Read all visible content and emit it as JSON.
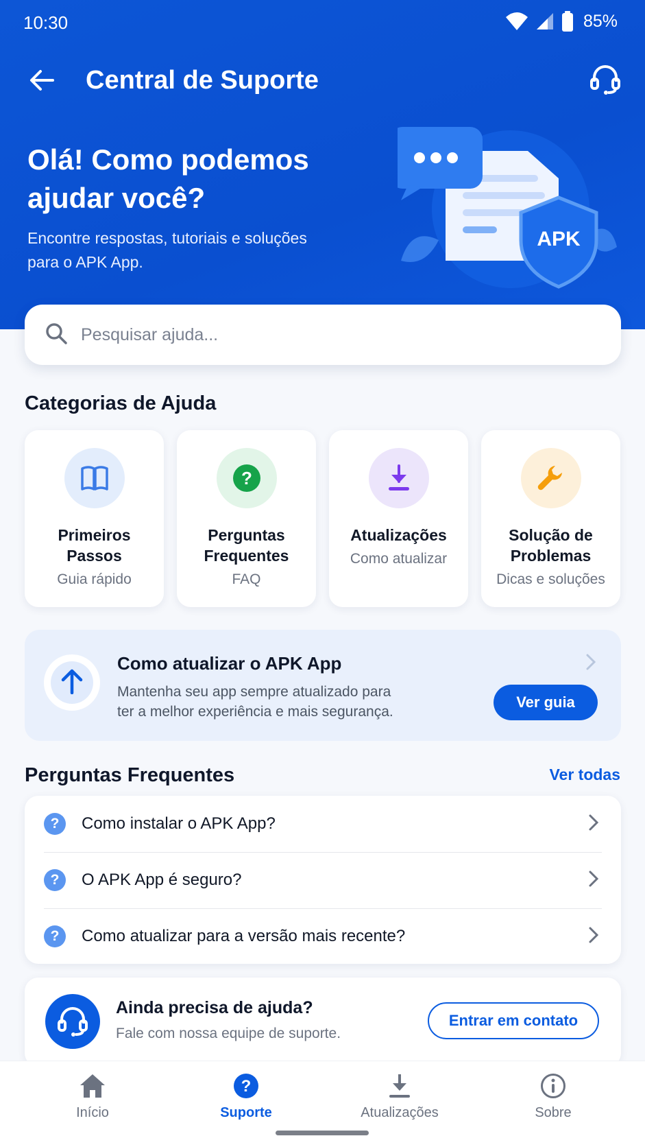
{
  "status_bar": {
    "time": "10:30",
    "battery": "85%",
    "icons": [
      "wifi-icon",
      "signal-icon",
      "battery-icon"
    ]
  },
  "app_bar": {
    "title": "Central de Suporte",
    "back_icon": "arrow-left-icon",
    "action_icon": "headset-icon"
  },
  "hero": {
    "title": "Olá! Como podemos ajudar você?",
    "subtitle": "Encontre respostas, tutoriais e soluções para o APK App.",
    "illustration_badge": "APK"
  },
  "search": {
    "placeholder": "Pesquisar ajuda...",
    "value": ""
  },
  "categories": {
    "title": "Categorias de Ajuda",
    "items": [
      {
        "title": "Primeiros Passos",
        "subtitle": "Guia rápido",
        "icon": "book-icon",
        "color": "#3b7be6",
        "bg": "#e3edfc"
      },
      {
        "title": "Perguntas Frequentes",
        "subtitle": "FAQ",
        "icon": "question-circle-icon",
        "color": "#16a34a",
        "bg": "#e2f5e8"
      },
      {
        "title": "Atualizações",
        "subtitle": "Como atualizar",
        "icon": "download-icon",
        "color": "#7c3aed",
        "bg": "#ece5fb"
      },
      {
        "title": "Solução de Problemas",
        "subtitle": "Dicas e soluções",
        "icon": "wrench-icon",
        "color": "#f59e0b",
        "bg": "#fdf0da"
      }
    ]
  },
  "update_card": {
    "title": "Como atualizar o APK App",
    "description": "Mantenha seu app sempre atualizado para ter a melhor experiência e mais segurança.",
    "button": "Ver guia",
    "icon": "arrow-up-icon"
  },
  "faq": {
    "title": "Perguntas Frequentes",
    "see_all": "Ver todas",
    "items": [
      {
        "question": "Como instalar o APK App?"
      },
      {
        "question": "O APK App é seguro?"
      },
      {
        "question": "Como atualizar para a versão mais recente?"
      }
    ]
  },
  "help_card": {
    "title": "Ainda precisa de ajuda?",
    "subtitle": "Fale com nossa equipe de suporte.",
    "button": "Entrar em contato",
    "icon": "headset-icon"
  },
  "bottom_nav": {
    "items": [
      {
        "label": "Início",
        "icon": "home-icon",
        "active": false
      },
      {
        "label": "Suporte",
        "icon": "question-circle-icon",
        "active": true
      },
      {
        "label": "Atualizações",
        "icon": "download-icon",
        "active": false
      },
      {
        "label": "Sobre",
        "icon": "info-icon",
        "active": false
      }
    ]
  },
  "colors": {
    "primary": "#0b5ce0",
    "hero_background": "#0d56d6",
    "page_background": "#f6f8fc"
  }
}
